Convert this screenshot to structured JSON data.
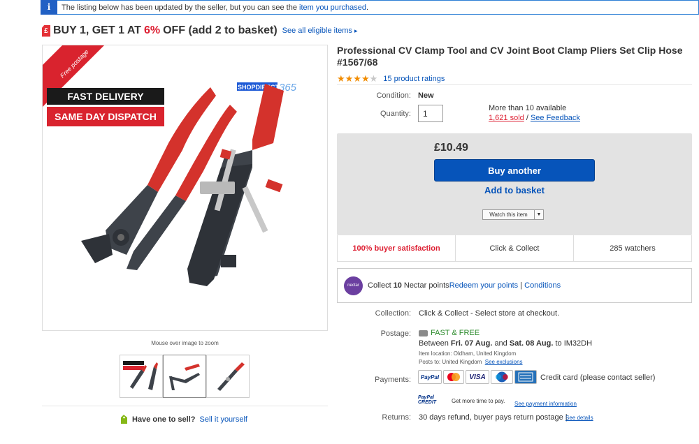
{
  "notice": {
    "text": "The listing below has been updated by the seller, but you can see the",
    "link": "item you purchased",
    "suffix": "."
  },
  "promo": {
    "prefix": "BUY 1, GET 1 AT",
    "percent": "6%",
    "suffix": "OFF (add 2 to basket)",
    "link": "See all eligible items",
    "arrow": "▸"
  },
  "image": {
    "ribbon": "Free postage",
    "banner1": "FAST DELIVERY",
    "banner2": "SAME DAY DISPATCH",
    "brand_a": "SHOPDIRECT",
    "brand_b": "365",
    "zoom_hint": "Mouse over image to zoom"
  },
  "sell": {
    "label": "Have one to sell?",
    "link": "Sell it yourself"
  },
  "product": {
    "title": "Professional CV Clamp Tool and CV Joint Boot Clamp Pliers Set Clip Hose #1567/68",
    "rating_stars": 4,
    "rating_count": "15 product ratings",
    "condition_label": "Condition:",
    "condition": "New",
    "quantity_label": "Quantity:",
    "quantity": "1",
    "available": "More than 10 available",
    "sold": "1,621 sold",
    "sep": "/",
    "feedback": "See Feedback"
  },
  "buy": {
    "price": "£10.49",
    "buy_label": "Buy another",
    "basket_label": "Add to basket",
    "watch_label": "Watch this item"
  },
  "stats": {
    "satisfaction": "100% buyer satisfaction",
    "collect": "Click & Collect",
    "watchers": "285 watchers"
  },
  "nectar": {
    "logo": "nectar",
    "prefix": "Collect",
    "points": "10",
    "suffix": "Nectar points",
    "redeem": "Redeem your points",
    "sep": "|",
    "conditions": "Conditions"
  },
  "details": {
    "collection_label": "Collection:",
    "collection": "Click & Collect - Select store at checkout.",
    "postage_label": "Postage:",
    "postage_fast": "FAST & FREE",
    "between": "Between",
    "date1": "Fri. 07 Aug.",
    "and": "and",
    "date2": "Sat. 08 Aug.",
    "to": "to IM32DH",
    "location": "Item location:  Oldham, United Kingdom",
    "posts_to": "Posts to:  United Kingdom",
    "exclusions": "See exclusions",
    "payments_label": "Payments:",
    "credit_card": "Credit card (please contact seller)",
    "pay_icons": [
      "PayPal",
      "Mastercard",
      "VISA",
      "Maestro",
      "Amex"
    ],
    "ppcredit_a": "PayPal",
    "ppcredit_b": "CREDIT",
    "more_time": "Get more time to pay.",
    "payment_info": "See payment information",
    "returns_label": "Returns:",
    "returns": "30 days refund, buyer pays return postage |",
    "see_details": "See details"
  },
  "colors": {
    "link": "#0654ba",
    "accent_red": "#dd1e31",
    "buy_button": "#0654ba",
    "star": "#f18c00"
  }
}
